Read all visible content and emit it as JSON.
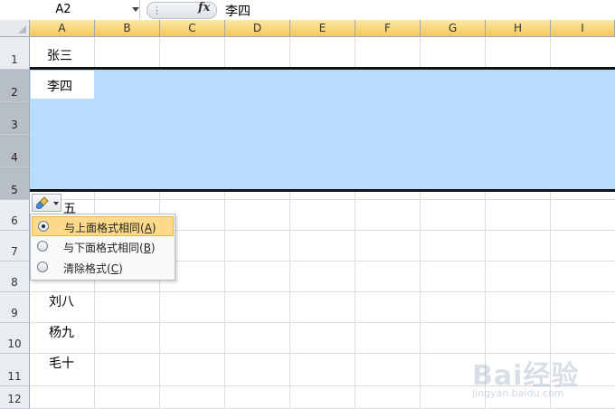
{
  "formula_bar": {
    "name_box": "A2",
    "fx_label": "fx",
    "value": "李四"
  },
  "columns": [
    "A",
    "B",
    "C",
    "D",
    "E",
    "F",
    "G",
    "H",
    "I"
  ],
  "rows": [
    "1",
    "2",
    "3",
    "4",
    "5",
    "6",
    "7",
    "8",
    "9",
    "10",
    "11",
    "12"
  ],
  "cells": {
    "A1": "张三",
    "A2": "李四",
    "A6": "五",
    "A9": "刘八",
    "A10": "杨九",
    "A11": "毛十"
  },
  "insert_options": {
    "items": [
      {
        "label": "与上面格式相同(A)",
        "pre": "与上面格式相同(",
        "key": "A",
        "post": ")",
        "selected": true
      },
      {
        "label": "与下面格式相同(B)",
        "pre": "与下面格式相同(",
        "key": "B",
        "post": ")",
        "selected": false
      },
      {
        "label": "清除格式(C)",
        "pre": "清除格式(",
        "key": "C",
        "post": ")",
        "selected": false
      }
    ]
  },
  "watermark": {
    "text": "Bai经验",
    "sub": "jingyan.baidu.com"
  },
  "colors": {
    "selection": "#b8dcfd",
    "header_selected": "#f6c85a",
    "menu_highlight": "#fdd98a"
  }
}
